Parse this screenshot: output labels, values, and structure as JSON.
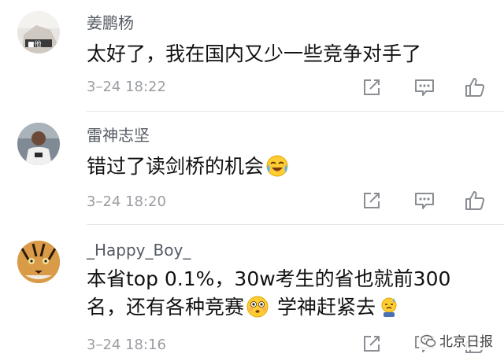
{
  "comments": [
    {
      "username": "姜鹏杨",
      "text": "太好了，我在国内又少一些竞争对手了",
      "time": "3–24 18:22"
    },
    {
      "username": "雷神志坚",
      "text": "错过了读剑桥的机会",
      "emoji": "crying-laughing-emoji",
      "time": "3–24 18:20"
    },
    {
      "username": "_Happy_Boy_",
      "text_part1": "本省top 0.1%，30w考生的省也就前300名，还有各种竞赛",
      "emoji1": "flushed-face-emoji",
      "text_part2": "学神赶紧去",
      "emoji2": "sweating-emoji",
      "time": "3–24 18:16"
    }
  ],
  "icons": [
    "share-icon",
    "reply-icon",
    "like-icon"
  ],
  "watermark": "北京日报"
}
